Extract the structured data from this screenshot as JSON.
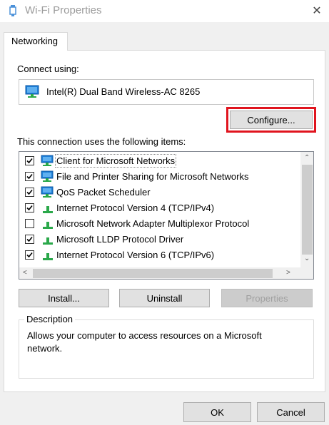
{
  "window": {
    "title": "Wi-Fi Properties",
    "close_glyph": "✕"
  },
  "tabs": [
    {
      "label": "Networking",
      "active": true
    }
  ],
  "connect_using": {
    "label": "Connect using:",
    "adapter_name": "Intel(R) Dual Band Wireless-AC 8265",
    "adapter_icon": "network-adapter-icon"
  },
  "configure_button": {
    "label": "Configure...",
    "highlighted": true,
    "highlight_color": "#e0141e"
  },
  "items_section": {
    "label": "This connection uses the following items:",
    "items": [
      {
        "label": "Client for Microsoft Networks",
        "checked": true,
        "icon": "network-client-icon",
        "selected": true
      },
      {
        "label": "File and Printer Sharing for Microsoft Networks",
        "checked": true,
        "icon": "network-client-icon",
        "selected": false
      },
      {
        "label": "QoS Packet Scheduler",
        "checked": true,
        "icon": "network-client-icon",
        "selected": false
      },
      {
        "label": "Internet Protocol Version 4 (TCP/IPv4)",
        "checked": true,
        "icon": "protocol-icon",
        "selected": false
      },
      {
        "label": "Microsoft Network Adapter Multiplexor Protocol",
        "checked": false,
        "icon": "protocol-icon",
        "selected": false
      },
      {
        "label": "Microsoft LLDP Protocol Driver",
        "checked": true,
        "icon": "protocol-icon",
        "selected": false
      },
      {
        "label": "Internet Protocol Version 6 (TCP/IPv6)",
        "checked": true,
        "icon": "protocol-icon",
        "selected": false
      }
    ]
  },
  "action_buttons": {
    "install": "Install...",
    "uninstall": "Uninstall",
    "properties": "Properties"
  },
  "description": {
    "title": "Description",
    "text": "Allows your computer to access resources on a Microsoft network."
  },
  "footer": {
    "ok": "OK",
    "cancel": "Cancel"
  },
  "colors": {
    "title_text": "#9b9b9b",
    "icon_monitor": "#1e7fd8",
    "icon_green": "#2aa84a"
  }
}
